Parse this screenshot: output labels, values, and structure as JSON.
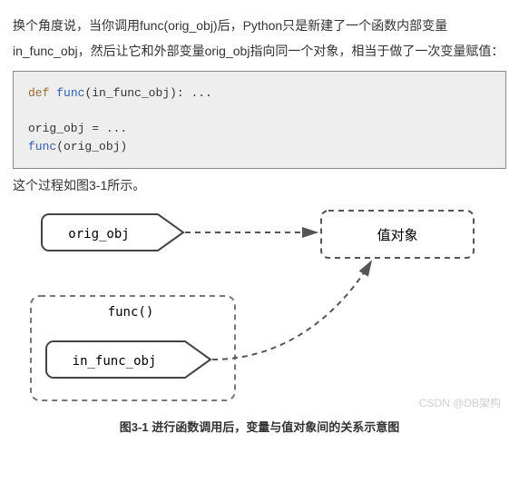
{
  "para1": "换个角度说，当你调用func(orig_obj)后，Python只是新建了一个函数内部变量in_func_obj，然后让它和外部变量orig_obj指向同一个对象，相当于做了一次变量赋值：",
  "code": {
    "kw_def": "def",
    "fn_name": "func",
    "def_rest": "(in_func_obj): ...",
    "assign": "orig_obj = ...",
    "call_fn": "func",
    "call_args": "(orig_obj)"
  },
  "para2": "这个过程如图3-1所示。",
  "diagram": {
    "box_orig": "orig_obj",
    "box_value": "值对象",
    "label_func": "func()",
    "box_infunc": "in_func_obj"
  },
  "caption": "图3-1 进行函数调用后，变量与值对象间的关系示意图",
  "watermark": "CSDN @DB架构"
}
